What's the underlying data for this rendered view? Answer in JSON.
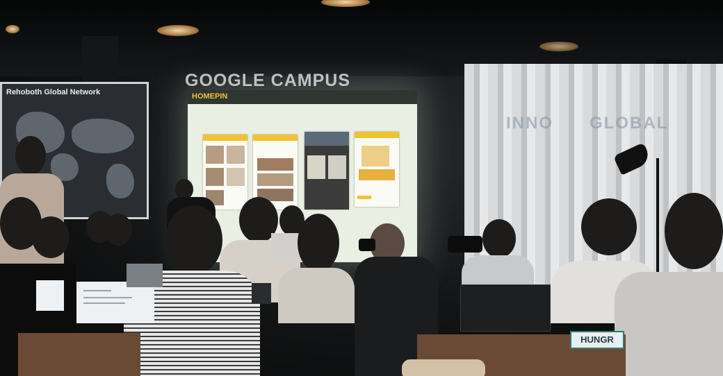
{
  "scene": {
    "world_map": {
      "title": "Rehoboth Global Network"
    },
    "wall_sign": "GOOGLE CAMPUS",
    "curtain_words": [
      "INNO",
      "GLOBAL"
    ],
    "projection": {
      "brand": "HOMEPIN",
      "menu_items": [
        "",
        "",
        "",
        ""
      ]
    },
    "name_tag": "HUNGR"
  },
  "colors": {
    "brand_yellow": "#f1c232",
    "screen_bg": "#e9efe3",
    "room_dark": "#0d0e0f"
  },
  "icons": [
    "pendant-lamp-icon",
    "desk-lamp-icon",
    "laptop-icon",
    "camera-icon"
  ]
}
